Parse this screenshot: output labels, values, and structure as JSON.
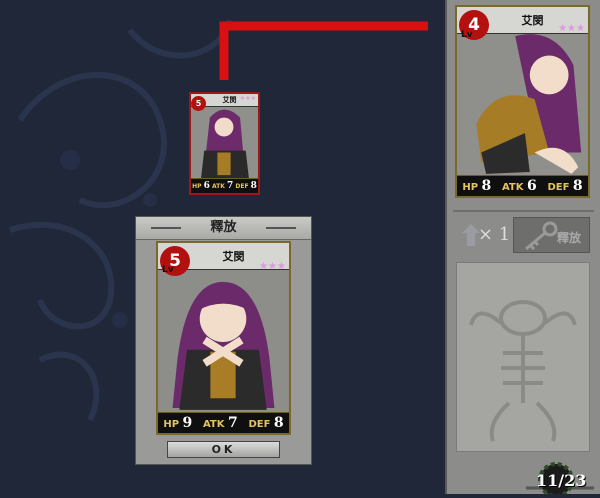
{
  "small_card": {
    "level": "5",
    "name": "艾閔",
    "stars": "★★★",
    "stats": {
      "hp_label": "HP",
      "hp": "6",
      "atk_label": "ATK",
      "atk": "7",
      "def_label": "DEF",
      "def": "8"
    }
  },
  "right_card": {
    "level": "4",
    "lv_label": "Lv",
    "name": "艾閔",
    "stars": "★★★",
    "stats": {
      "hp_label": "HP",
      "hp": "8",
      "atk_label": "ATK",
      "atk": "6",
      "def_label": "DEF",
      "def": "8"
    }
  },
  "release_dialog": {
    "title": "釋放",
    "card": {
      "level": "5",
      "lv_label": "Lv",
      "name": "艾閔",
      "stars": "★★★",
      "stats": {
        "hp_label": "HP",
        "hp": "9",
        "atk_label": "ATK",
        "atk": "7",
        "def_label": "DEF",
        "def": "8"
      }
    },
    "ok_label": "OK"
  },
  "side_panel": {
    "item_count": "× 1",
    "release_button_label": "釋放"
  },
  "page_counter": "11/23",
  "colors": {
    "background": "#1f2739",
    "red_accent": "#d91010",
    "gold_stat": "#e3c463",
    "panel_gray": "#8c8c8a"
  }
}
